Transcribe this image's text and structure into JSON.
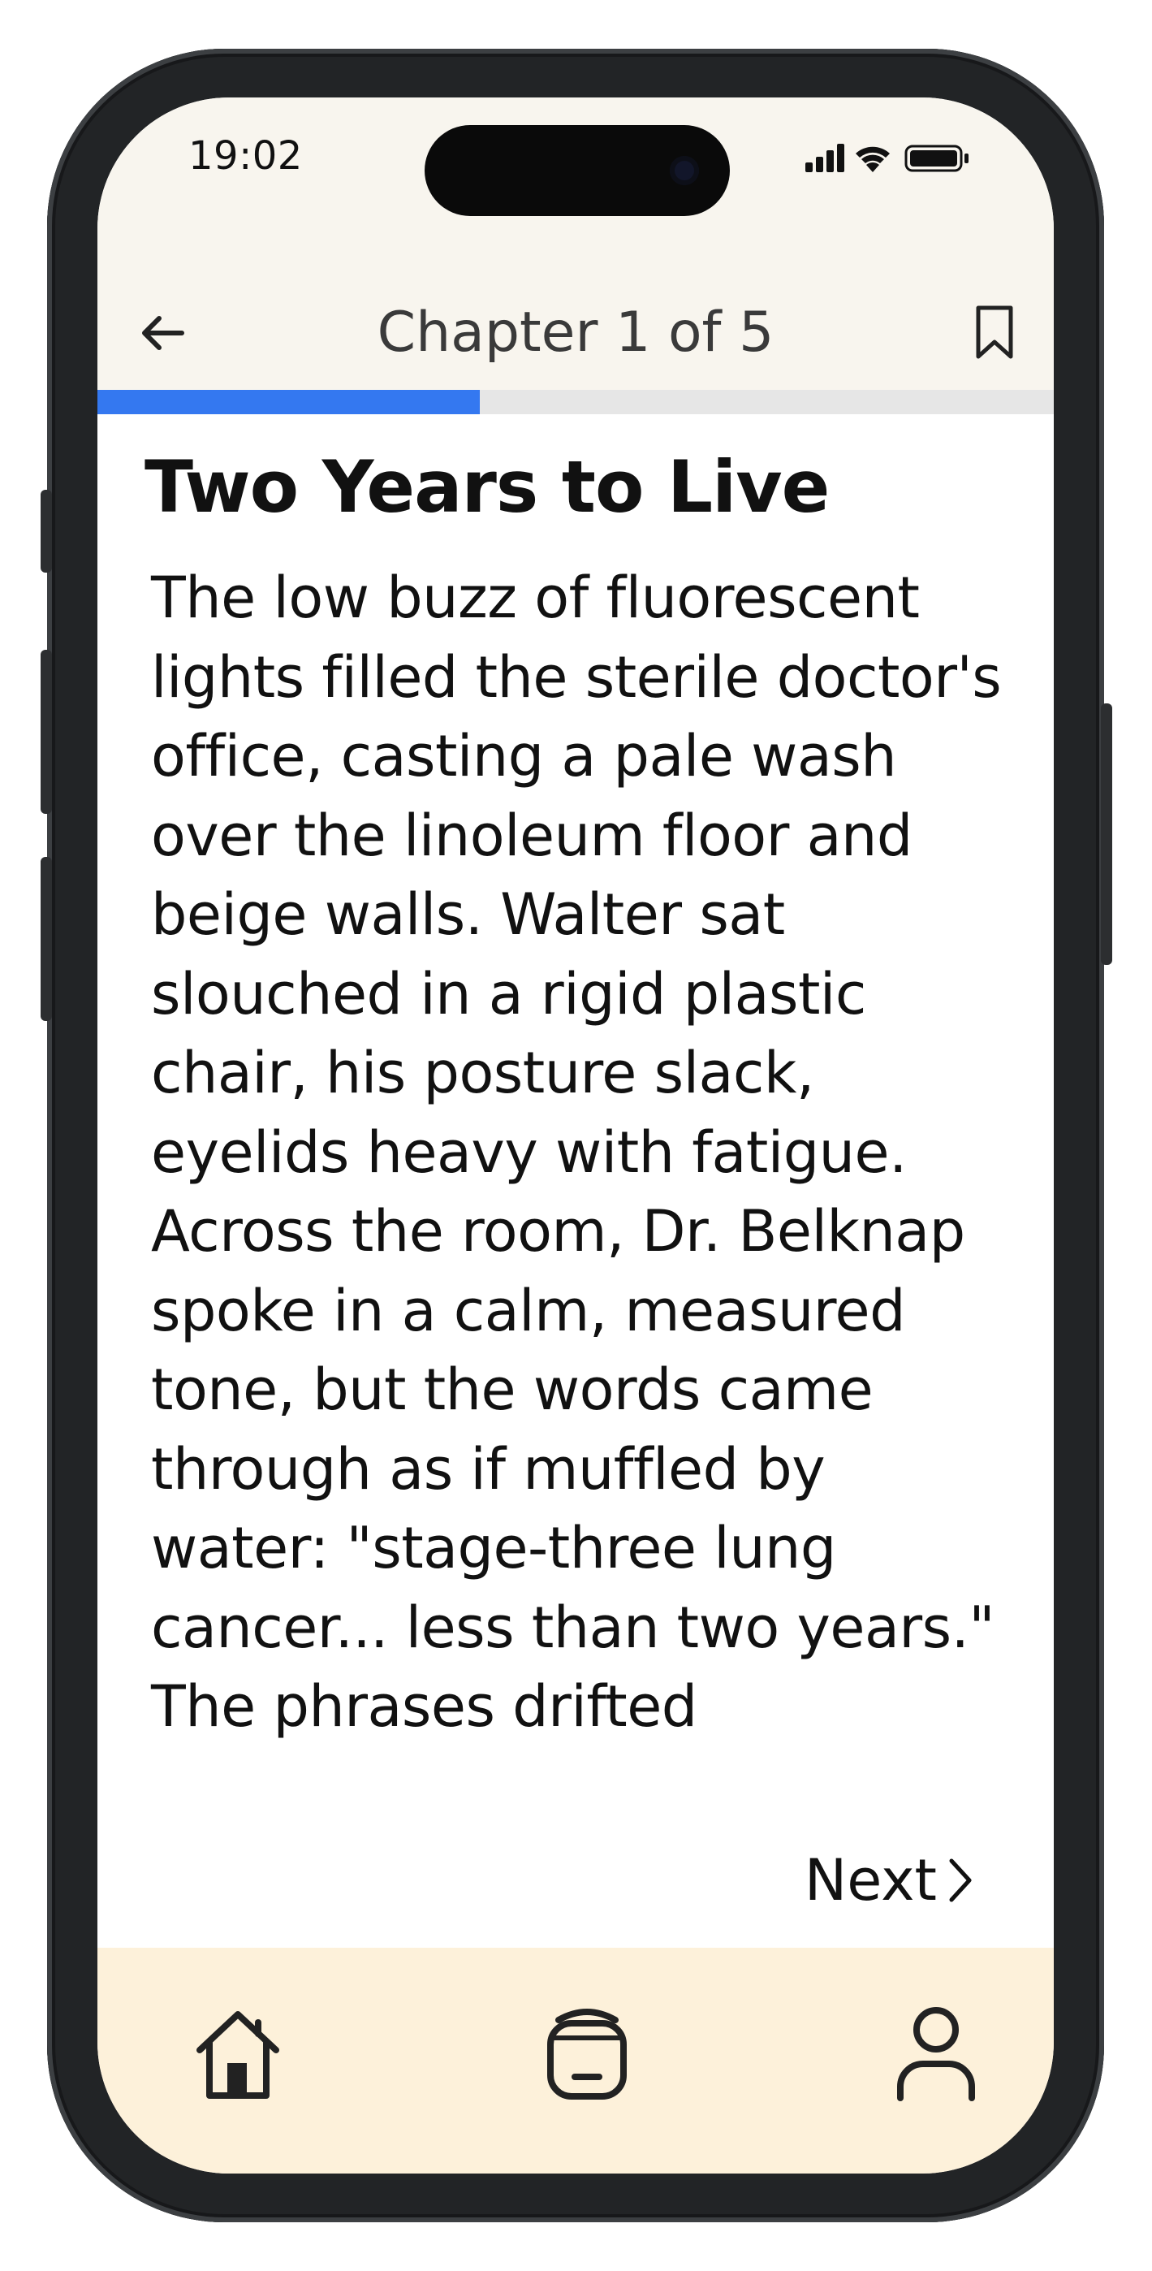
{
  "status_bar": {
    "time": "19:02"
  },
  "header": {
    "chapter_label": "Chapter 1 of 5"
  },
  "progress": {
    "current_chapter": 1,
    "total_chapters": 5,
    "fraction": 0.4,
    "fill_color": "#3478f0"
  },
  "story": {
    "title": "Two Years to Live",
    "text": "The low buzz of fluorescent lights filled the sterile doctor's office, casting a pale wash over the linoleum floor and beige walls. Walter sat slouched in a rigid plastic chair, his posture slack, eyelids heavy with fatigue. Across the room, Dr. Belknap spoke in a calm, measured tone, but the words came through as if muffled by water: \"stage-three lung cancer... less than two years.\" The phrases drifted"
  },
  "navigation": {
    "next_label": "Next"
  },
  "icons": {
    "back": "arrow-left-icon",
    "bookmark": "bookmark-icon",
    "next": "chevron-right-icon",
    "home": "home-icon",
    "library": "library-icon",
    "profile": "user-icon"
  },
  "colors": {
    "header_background": "#f8f5ee",
    "bottom_nav_background": "#fdf1da",
    "progress_track": "#e6e6e6"
  }
}
